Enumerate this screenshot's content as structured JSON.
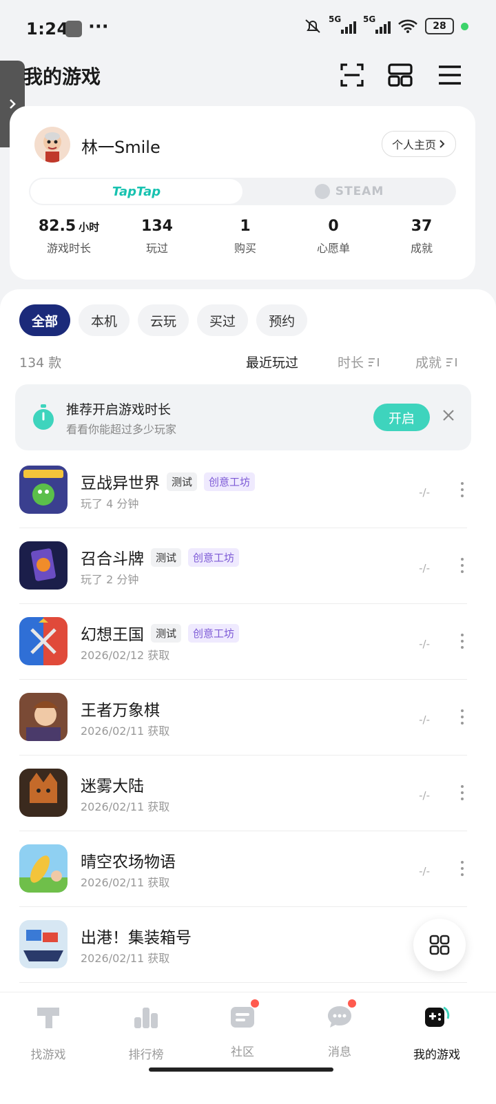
{
  "status_bar": {
    "time": "1:24",
    "battery": "28",
    "network_1": "5G",
    "network_2": "5G"
  },
  "header": {
    "title": "我的游戏"
  },
  "profile": {
    "username": "林一Smile",
    "homepage_label": "个人主页",
    "platforms": {
      "taptap": "TapTap",
      "steam": "STEAM"
    },
    "stats": [
      {
        "value": "82.5",
        "unit": "小时",
        "label": "游戏时长"
      },
      {
        "value": "134",
        "label": "玩过"
      },
      {
        "value": "1",
        "label": "购买"
      },
      {
        "value": "0",
        "label": "心愿单"
      },
      {
        "value": "37",
        "label": "成就"
      }
    ]
  },
  "filters": {
    "chips": [
      "全部",
      "本机",
      "云玩",
      "买过",
      "预约"
    ],
    "active": "全部"
  },
  "list_meta": {
    "count": "134 款",
    "sort_recent": "最近玩过",
    "sort_duration": "时长",
    "sort_achievement": "成就"
  },
  "banner": {
    "title": "推荐开启游戏时长",
    "subtitle": "看看你能超过多少玩家",
    "button": "开启"
  },
  "games": [
    {
      "name": "豆战异世界",
      "tags": [
        "测试",
        "创意工坊"
      ],
      "sub": "玩了 4 分钟",
      "duration": "-/-"
    },
    {
      "name": "召合斗牌",
      "tags": [
        "测试",
        "创意工坊"
      ],
      "sub": "玩了 2 分钟",
      "duration": "-/-"
    },
    {
      "name": "幻想王国",
      "tags": [
        "测试",
        "创意工坊"
      ],
      "sub": "2026/02/12 获取",
      "duration": "-/-"
    },
    {
      "name": "王者万象棋",
      "tags": [],
      "sub": "2026/02/11 获取",
      "duration": "-/-"
    },
    {
      "name": "迷雾大陆",
      "tags": [],
      "sub": "2026/02/11 获取",
      "duration": "-/-"
    },
    {
      "name": "晴空农场物语",
      "tags": [],
      "sub": "2026/02/11 获取",
      "duration": "-/-"
    },
    {
      "name": "出港！集装箱号",
      "tags": [],
      "sub": "2026/02/11 获取",
      "duration": ""
    }
  ],
  "bottom_nav": [
    {
      "label": "找游戏"
    },
    {
      "label": "排行榜"
    },
    {
      "label": "社区"
    },
    {
      "label": "消息"
    },
    {
      "label": "我的游戏"
    }
  ],
  "colors": {
    "accent": "#3ed4bd",
    "chip_active": "#1b2a7a",
    "workshop_tag": "#7d5ad6",
    "badge": "#ff5a4e"
  }
}
